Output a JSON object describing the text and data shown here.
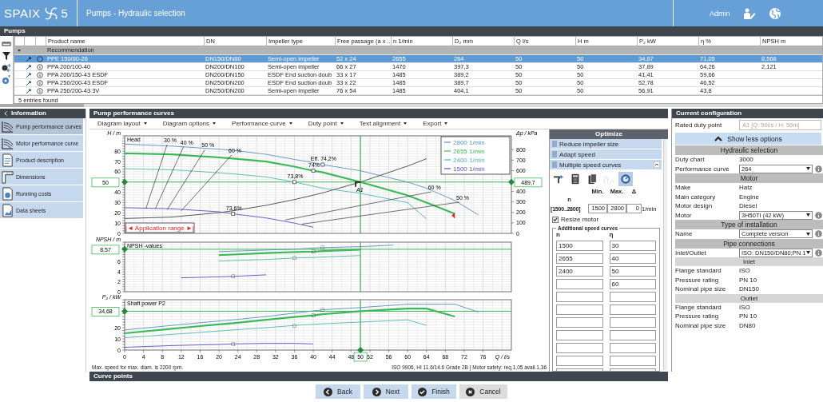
{
  "header": {
    "logo": "SPAIX",
    "logo_number": "5",
    "title": "Pumps - Hydraulic selection",
    "user": "Admin"
  },
  "pumps": {
    "title": "Pumps",
    "columns": [
      "Product name",
      "DN",
      "Impeller type",
      "Free passage (a x ...",
      "n 1/min",
      "D₂ mm",
      "Q l/s",
      "H m",
      "P₂ kW",
      "η %",
      "NPSH m"
    ],
    "group": {
      "label": "Recommendation",
      "expanded": true
    },
    "rows": [
      {
        "selected": true,
        "cells": [
          "PPE 150/80-26",
          "DN150/DN80",
          "Semi-open impeller",
          "52 x 24",
          "2655",
          "264",
          "50",
          "50",
          "34,67",
          "71,05",
          "8,568"
        ]
      },
      {
        "selected": false,
        "cells": [
          "PPA 200/100-40",
          "DN200/DN100",
          "Semi-open impeller",
          "66 x 27",
          "1470",
          "397,3",
          "50",
          "50",
          "37,89",
          "64,26",
          "2,121"
        ]
      },
      {
        "selected": false,
        "cells": [
          "PPA 200/150-43 ESDF",
          "DN200/DN150",
          "ESDF End suction doub",
          "33 x 17",
          "1485",
          "389,2",
          "50",
          "50",
          "41,41",
          "59,66"
        ]
      },
      {
        "selected": false,
        "cells": [
          "PPA 250/200-43 ESDF",
          "DN250/DN200",
          "ESDF End suction doub",
          "33 x 22",
          "1485",
          "389,7",
          "50",
          "50",
          "52,78",
          "46,52"
        ]
      },
      {
        "selected": false,
        "cells": [
          "PPA 250/200-43 3V",
          "DN250/DN200",
          "Semi-open impeller",
          "76 x 54",
          "1485",
          "404,1",
          "50",
          "50",
          "56,91",
          "43,8"
        ]
      }
    ],
    "footer": "5 entries found"
  },
  "information": {
    "title": "Information",
    "items": [
      {
        "label": "Pump performance curves",
        "selected": true
      },
      {
        "label": "Motor performance curve",
        "selected": false
      },
      {
        "label": "Product description",
        "selected": false
      },
      {
        "label": "Dimensions",
        "selected": false
      },
      {
        "label": "Running costs",
        "selected": false
      },
      {
        "label": "Data sheets",
        "selected": false
      }
    ]
  },
  "curves": {
    "title": "Pump performance curves",
    "menus": [
      "Diagram layout",
      "Diagram options",
      "Performance curve",
      "Duty point",
      "Text alignment",
      "Export"
    ],
    "speed_curves": [
      {
        "selected": false
      },
      {
        "selected": true
      },
      {
        "selected": false
      },
      {
        "selected": false
      }
    ],
    "head": {
      "right_value_box": "489,7",
      "right_axis_label": "Δp / kPa",
      "application_range": "|◄ Application range ►|",
      "right_ticks": [
        "800",
        "700",
        "600",
        "400",
        "300",
        "200",
        "100",
        "0"
      ],
      "chart_data": {
        "type": "line",
        "title": "Head",
        "ylabel": "H / m",
        "xlim": [
          0,
          82
        ],
        "ylim": [
          0,
          95
        ],
        "yticks": [
          0,
          10,
          20,
          30,
          40,
          60,
          70,
          80
        ],
        "grid": true,
        "legend": "upper right",
        "x": [
          0,
          10,
          20,
          23,
          30,
          36,
          40,
          42,
          50,
          60,
          64,
          70,
          75
        ],
        "series": [
          {
            "name": "2800 1/min",
            "color": "#5b8fc0",
            "values": [
              87,
              85,
              82,
              81,
              77,
              72,
              69,
              67,
              61,
              50,
              44,
              32,
              18
            ]
          },
          {
            "name": "2655 1/min",
            "color": "#3cb95a",
            "values": [
              78,
              77,
              74,
              73,
              70,
              65,
              61,
              59.5,
              50,
              37,
              30,
              19,
              null
            ]
          },
          {
            "name": "2400 1/min",
            "color": "#4fb7b3",
            "values": [
              63,
              62,
              59,
              58,
              55,
              50,
              46,
              44,
              39,
              30,
              14,
              null,
              null
            ]
          },
          {
            "name": "1500 1/min",
            "color": "#5a4fc0",
            "values": [
              25,
              24,
              21,
              19,
              15,
              10,
              6,
              null,
              null,
              null,
              null,
              null,
              null
            ]
          },
          {
            "color": "#444444",
            "values": [
              14.5,
              15.9,
              20.2,
              22,
              27.3,
              32.9,
              37.2,
              39.5,
              50,
              65.6,
              72.7,
              null,
              null
            ]
          }
        ],
        "ref_lines": [
          {
            "axis": "x",
            "value": 50,
            "color": "#2e9b4a"
          },
          {
            "axis": "y",
            "value": 50,
            "color": "#3cb95a",
            "label": "50"
          }
        ],
        "annotations": [
          "30 %",
          "40 %",
          "50 %",
          "60 %",
          "60 %",
          "50 %",
          {
            "text": "Eff. 74,2%",
            "x": 42,
            "y": 67
          },
          {
            "text": "74%",
            "x": 40,
            "y": 61
          },
          {
            "text": "73,8%",
            "x": 36,
            "y": 50
          },
          {
            "text": "73,6%",
            "x": 23,
            "y": 19
          },
          {
            "text": "A1",
            "x": 50,
            "y": 50
          }
        ]
      }
    },
    "npsh": {
      "chart_data": {
        "type": "line",
        "title": "NPSH -values",
        "ylabel": "NPSH / m",
        "xlim": [
          0,
          82
        ],
        "ylim": [
          0,
          10
        ],
        "yticks": [
          0,
          2,
          4,
          6
        ],
        "grid": true,
        "x": [
          12,
          20,
          23,
          30,
          36,
          40,
          42,
          50,
          57
        ],
        "series": [
          {
            "color": "#5b8fc0",
            "values": [
              null,
              8.1,
              8.2,
              8.4,
              8.6,
              8.8,
              8.9,
              9.1,
              9.4
            ]
          },
          {
            "color": "#3cb95a",
            "values": [
              null,
              7.4,
              7.5,
              7.8,
              8.0,
              8.1,
              8.2,
              8.5,
              null
            ]
          },
          {
            "color": "#4fb7b3",
            "values": [
              null,
              6.2,
              6.3,
              6.5,
              6.8,
              6.9,
              7.0,
              7.3,
              null
            ]
          },
          {
            "color": "#5a4fc0",
            "values": [
              2.8,
              3.0,
              3.1,
              3.4,
              null,
              null,
              null,
              null,
              null
            ]
          }
        ],
        "ref_lines": [
          {
            "axis": "x",
            "value": 50,
            "color": "#2e9b4a"
          },
          {
            "axis": "y",
            "value": 8.57,
            "color": "#3cb95a",
            "label": "8,57"
          }
        ],
        "annotations": [
          {
            "text": "□",
            "x": 42,
            "y": 8.9
          },
          {
            "text": "□",
            "x": 40,
            "y": 8.1
          },
          {
            "text": "□",
            "x": 36,
            "y": 6.8
          },
          {
            "text": "□",
            "x": 23,
            "y": 3.1
          }
        ]
      }
    },
    "power": {
      "chart_data": {
        "type": "line",
        "title": "Shaft power P2",
        "ylabel": "P₂ / kW",
        "xlabel": "Q / l/s",
        "xlim": [
          0,
          82
        ],
        "ylim": [
          0,
          45
        ],
        "yticks": [
          0,
          10,
          20
        ],
        "grid": true,
        "xticks": [
          0,
          4,
          8,
          12,
          16,
          20,
          24,
          28,
          32,
          36,
          40,
          44,
          48,
          52,
          56,
          60,
          64,
          68,
          72,
          76
        ],
        "x": [
          0,
          10,
          20,
          23,
          30,
          36,
          40,
          42,
          50,
          60,
          64,
          70,
          75
        ],
        "series": [
          {
            "color": "#5b8fc0",
            "values": [
              18,
              22,
              26,
              27,
              30,
              33,
              35,
              36,
              38,
              41,
              41,
              41,
              34
            ]
          },
          {
            "color": "#3cb95a",
            "values": [
              15,
              19,
              23,
              24,
              27,
              29.5,
              31,
              32,
              34.7,
              37,
              37,
              30,
              null
            ]
          },
          {
            "color": "#4fb7b3",
            "values": [
              11,
              14,
              17,
              18,
              20,
              22,
              23,
              23.5,
              25,
              27,
              22,
              null,
              null
            ]
          },
          {
            "color": "#5a4fc0",
            "values": [
              2.5,
              4,
              5,
              5.5,
              6,
              6,
              5.5,
              null,
              null,
              null,
              null,
              null,
              null
            ]
          }
        ],
        "ref_lines": [
          {
            "axis": "x",
            "value": 50,
            "color": "#2e9b4a",
            "label": "50"
          },
          {
            "axis": "y",
            "value": 34.68,
            "color": "#3cb95a",
            "label": "34,68"
          }
        ],
        "annotations": [
          {
            "text": "□",
            "x": 42,
            "y": 36
          },
          {
            "text": "□",
            "x": 40,
            "y": 31
          },
          {
            "text": "□",
            "x": 36,
            "y": 22
          },
          {
            "text": "□",
            "x": 23,
            "y": 5.5
          }
        ]
      }
    },
    "notes": [
      "Max. speed for max. diam. is 2200 rpm.",
      "ISO 9906, HI 11.6/14.6 Grade 2B | Motor safety: req.1,05 avail.1,36"
    ]
  },
  "optimize": {
    "title": "Optimize",
    "sections": [
      {
        "label": "Reduce impeller size",
        "expanded": false
      },
      {
        "label": "Adapt speed",
        "expanded": false
      },
      {
        "label": "Multiple speed curves",
        "expanded": true
      }
    ],
    "tools": [
      {
        "selected": false,
        "disabled": false
      },
      {
        "selected": false,
        "disabled": false
      },
      {
        "selected": false,
        "disabled": false
      },
      {
        "selected": false,
        "disabled": true
      },
      {
        "selected": true,
        "disabled": false
      }
    ],
    "range": {
      "label": "n",
      "hint": "[1500..2800]",
      "min_label": "Min.",
      "max_label": "Max.",
      "delta_label": "Δ",
      "min": "1500",
      "max": "2800",
      "delta": "0",
      "unit": "1/min"
    },
    "resize_motor": {
      "label": "Resize motor",
      "checked": true
    },
    "additional": {
      "title": "Additional speed curves",
      "n_label": "n",
      "eta_label": "η",
      "rows": [
        {
          "n": "1500",
          "eta": "30"
        },
        {
          "n": "2655",
          "eta": "40"
        },
        {
          "n": "2400",
          "eta": "50"
        },
        {
          "eta": "60"
        }
      ]
    }
  },
  "configuration": {
    "title": "Current configuration",
    "rated_duty_point": {
      "label": "Rated duty point",
      "value": "A1 [Q: 50l/s / H: 50m]",
      "disabled": true
    },
    "toggle": "Show less options",
    "rows": [
      {
        "kind": "section",
        "label": "Hydraulic selection"
      },
      {
        "kind": "text",
        "label": "Duty chart",
        "value": "3000"
      },
      {
        "kind": "select",
        "label": "Performance curve",
        "value": "264"
      },
      {
        "kind": "section",
        "label": "Motor"
      },
      {
        "kind": "text",
        "label": "Make",
        "value": "Hatz"
      },
      {
        "kind": "text",
        "label": "Main category",
        "value": "Engine"
      },
      {
        "kind": "text",
        "label": "Motor design",
        "value": "Diesel"
      },
      {
        "kind": "select",
        "label": "Motor",
        "value": "3H50TI (42 kW)"
      },
      {
        "kind": "section",
        "label": "Type of installation"
      },
      {
        "kind": "select",
        "label": "Name",
        "value": "Complete version"
      },
      {
        "kind": "section",
        "label": "Pipe connections"
      },
      {
        "kind": "select",
        "label": "Inlet/Outlet",
        "value": "ISO: DN150/DN80;PN 1"
      },
      {
        "kind": "subsection",
        "label": "Inlet"
      },
      {
        "kind": "text",
        "label": "Flange standard",
        "value": "ISO"
      },
      {
        "kind": "text",
        "label": "Pressure rating",
        "value": "PN 10"
      },
      {
        "kind": "text",
        "label": "Nominal pipe size",
        "value": "DN150"
      },
      {
        "kind": "subsection",
        "label": "Outlet"
      },
      {
        "kind": "text",
        "label": "Flange standard",
        "value": "ISO"
      },
      {
        "kind": "text",
        "label": "Pressure rating",
        "value": "PN 10"
      },
      {
        "kind": "text",
        "label": "Nominal pipe size",
        "value": "DN80"
      }
    ]
  },
  "curve_points": {
    "title": "Curve points"
  },
  "buttons": [
    {
      "label": "Back",
      "kind": "back"
    },
    {
      "label": "Next",
      "kind": "next"
    },
    {
      "label": "Finish",
      "kind": "finish"
    },
    {
      "label": "Cancel",
      "kind": "cancel"
    }
  ]
}
